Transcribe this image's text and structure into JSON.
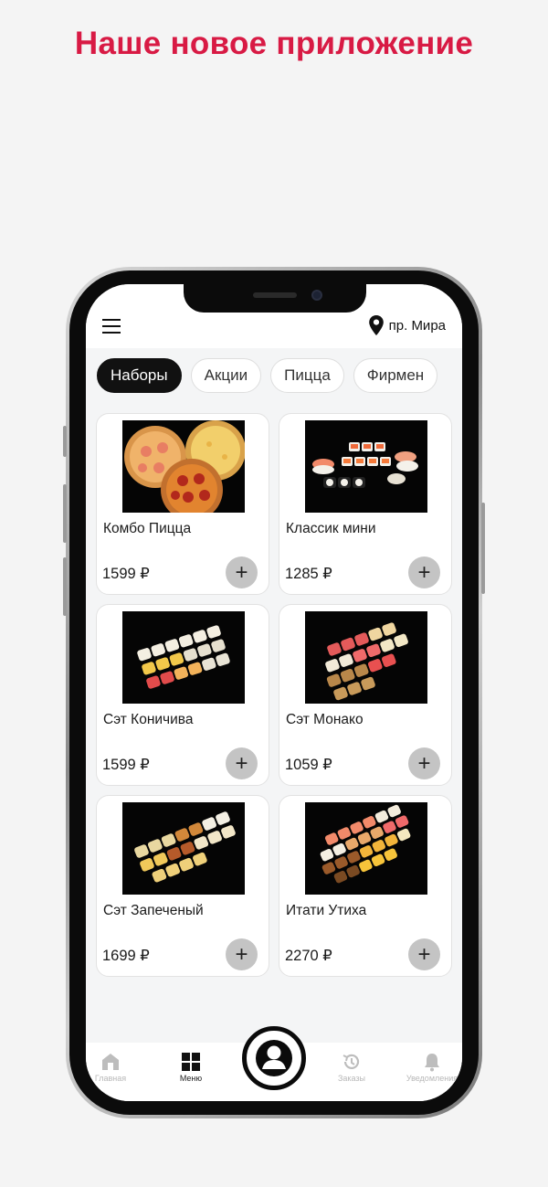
{
  "promo": {
    "title": "Наше новое приложение"
  },
  "header": {
    "location": "пр. Мира"
  },
  "categories": [
    "Наборы",
    "Акции",
    "Пицца",
    "Фирмен"
  ],
  "products": [
    {
      "name": "Комбо Пицца",
      "price": "1599 ₽",
      "add": "+"
    },
    {
      "name": "Классик мини",
      "price": "1285 ₽",
      "add": "+"
    },
    {
      "name": "Сэт Коничива",
      "price": "1599 ₽",
      "add": "+"
    },
    {
      "name": "Сэт Монако",
      "price": "1059 ₽",
      "add": "+"
    },
    {
      "name": "Сэт Запеченый",
      "price": "1699 ₽",
      "add": "+"
    },
    {
      "name": "Итати Утиха",
      "price": "2270 ₽",
      "add": "+"
    }
  ],
  "tabbar": {
    "home": "Главная",
    "menu": "Меню",
    "orders": "Заказы",
    "notifications": "Уведомления"
  },
  "colors": {
    "brand": "#d81a44",
    "active_chip": "#111111",
    "add_button": "#c4c4c4"
  }
}
